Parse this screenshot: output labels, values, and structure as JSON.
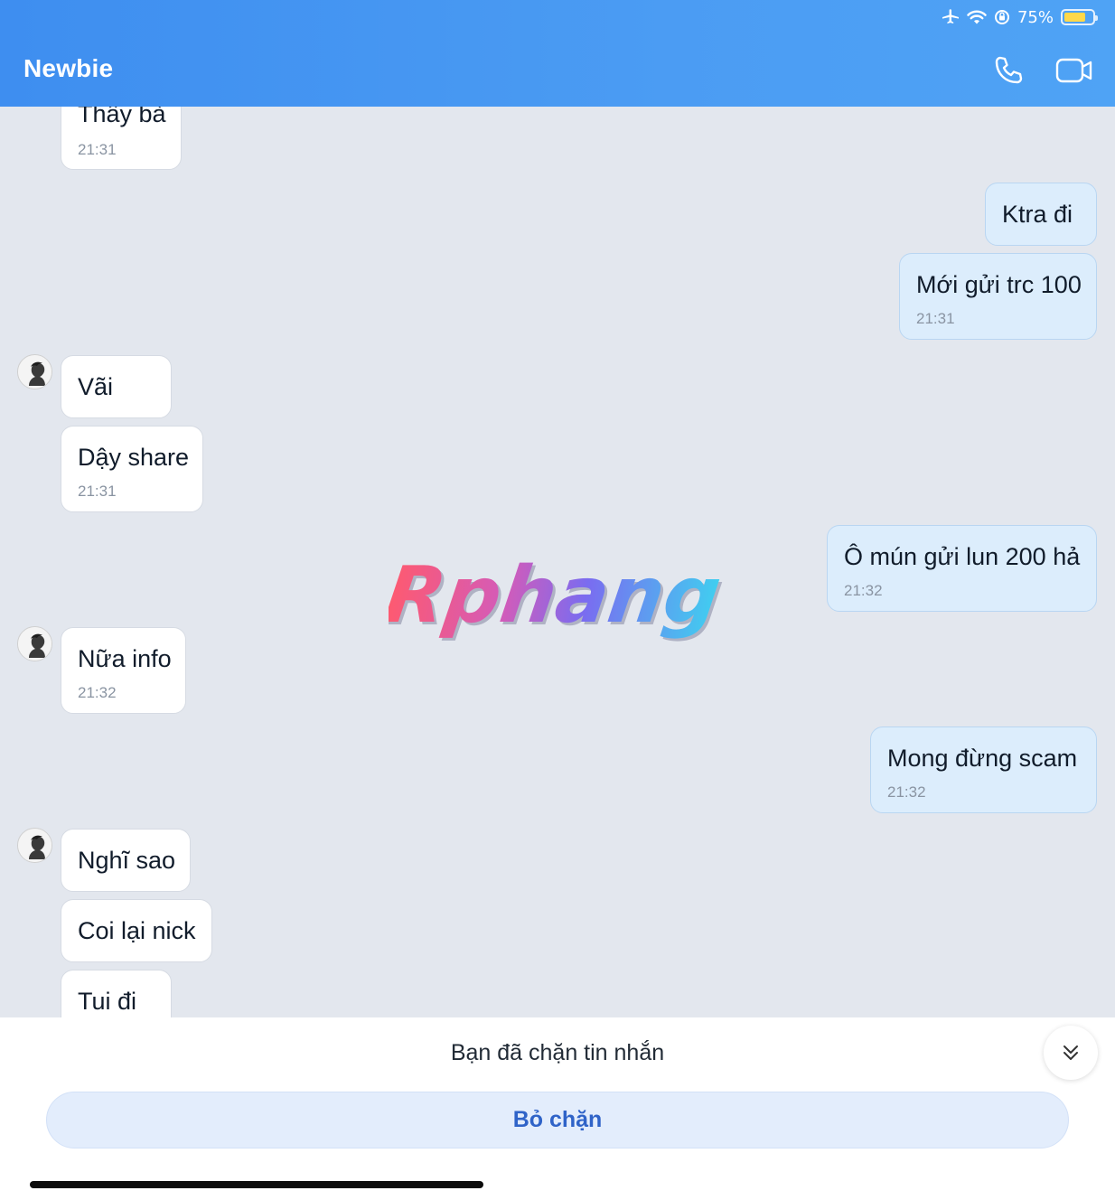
{
  "status_bar": {
    "airplane_icon": "airplane-icon",
    "wifi_icon": "wifi-icon",
    "orientation_lock_icon": "orientation-lock-icon",
    "battery_percent": "75%",
    "battery_level": 0.75,
    "battery_color": "#ffd84a"
  },
  "header": {
    "title": "Newbie",
    "call_icon": "phone-icon",
    "video_icon": "video-camera-icon",
    "gradient_start": "#3e8ef0",
    "gradient_end": "#4fa3f5"
  },
  "messages": [
    {
      "sender": "them",
      "text": "Thấy bà",
      "time": "21:31"
    },
    {
      "sender": "me",
      "text": "Ktra đi",
      "time": ""
    },
    {
      "sender": "me",
      "text": "Mới gửi trc 100",
      "time": "21:31"
    },
    {
      "sender": "them",
      "text": "Vãi",
      "time": ""
    },
    {
      "sender": "them",
      "text": "Dậy share",
      "time": "21:31"
    },
    {
      "sender": "me",
      "text": "Ô mún gửi lun 200 hả",
      "time": "21:32"
    },
    {
      "sender": "them",
      "text": "Nữa info",
      "time": "21:32"
    },
    {
      "sender": "me",
      "text": "Mong đừng scam",
      "time": "21:32"
    },
    {
      "sender": "them",
      "text": "Nghĩ sao",
      "time": ""
    },
    {
      "sender": "them",
      "text": "Coi lại nick",
      "time": ""
    },
    {
      "sender": "them",
      "text": "Tui đi",
      "time": ""
    }
  ],
  "watermark": {
    "text": "Rphang"
  },
  "bottom": {
    "blocked_text": "Bạn đã chặn tin nhắn",
    "unblock_label": "Bỏ chặn",
    "collapse_icon": "double-chevron-down-icon"
  },
  "colors": {
    "chat_background": "#e3e7ee",
    "my_bubble": "#dcedfc",
    "their_bubble": "#ffffff",
    "unblock_button": "#e3edfc",
    "unblock_text": "#2f63c8"
  }
}
